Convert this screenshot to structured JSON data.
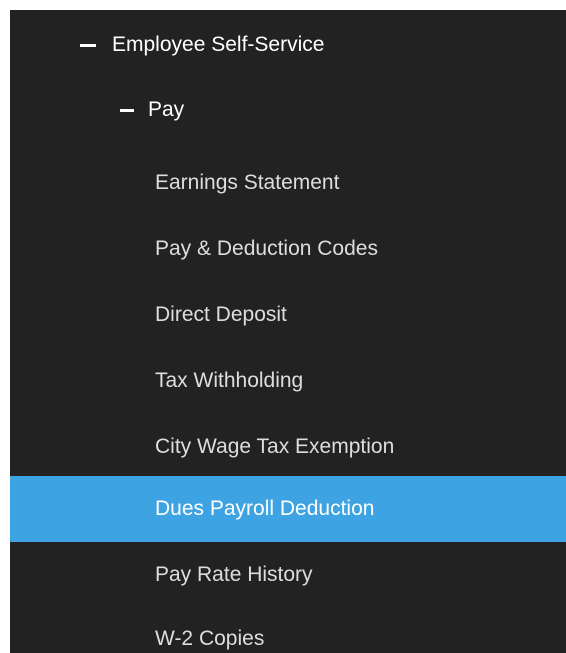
{
  "nav": {
    "section": {
      "label": "Employee Self-Service",
      "icon": "minus-icon"
    },
    "subsection": {
      "label": "Pay",
      "icon": "minus-icon"
    },
    "items": [
      {
        "label": "Earnings Statement"
      },
      {
        "label": "Pay & Deduction Codes"
      },
      {
        "label": "Direct Deposit"
      },
      {
        "label": "Tax Withholding"
      },
      {
        "label": "City Wage Tax Exemption"
      },
      {
        "label": "Dues Payroll Deduction",
        "active": true
      },
      {
        "label": "Pay Rate History"
      },
      {
        "label": "W-2 Copies"
      }
    ],
    "colors": {
      "background": "#222222",
      "active": "#3ea3e2",
      "text": "#ffffff"
    }
  }
}
